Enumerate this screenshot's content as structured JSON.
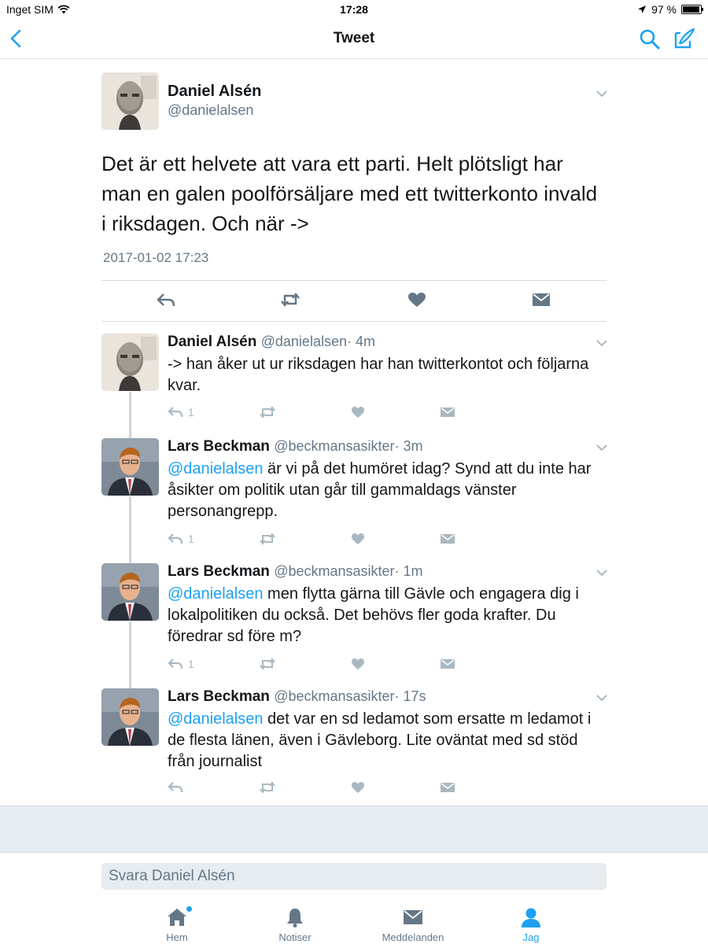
{
  "status_bar": {
    "carrier": "Inget SIM",
    "time": "17:28",
    "battery": "97 %",
    "battery_level": 0.97
  },
  "nav": {
    "title": "Tweet"
  },
  "main_tweet": {
    "name": "Daniel Alsén",
    "handle": "@danielalsen",
    "text": "Det är ett helvete att vara ett parti. Helt plötsligt har man en galen poolförsäljare med ett twitterkonto invald i riksdagen. Och när ->",
    "date": "2017-01-02 17:23"
  },
  "replies": [
    {
      "name": "Daniel Alsén",
      "handle": "@danielalsen",
      "time": "· 4m",
      "mention": "",
      "text": "-> han åker ut ur riksdagen har han twitterkontot och följarna kvar.",
      "reply_count": "1"
    },
    {
      "name": "Lars Beckman",
      "handle": "@beckmansasikter",
      "time": "· 3m",
      "mention": "@danielalsen",
      "text": " är vi på det humöret idag? Synd att du inte har åsikter om politik utan går till gammaldags vänster personangrepp.",
      "reply_count": "1"
    },
    {
      "name": "Lars Beckman",
      "handle": "@beckmansasikter",
      "time": "· 1m",
      "mention": "@danielalsen",
      "text": " men flytta gärna till Gävle och engagera dig i lokalpolitiken du också. Det behövs fler goda krafter. Du föredrar sd före m?",
      "reply_count": "1"
    },
    {
      "name": "Lars Beckman",
      "handle": "@beckmansasikter",
      "time": "· 17s",
      "mention": "@danielalsen",
      "text": " det var en sd ledamot som ersatte m ledamot i de flesta länen, även i Gävleborg. Lite oväntat med sd stöd från journalist",
      "reply_count": ""
    }
  ],
  "reply_box": {
    "placeholder": "Svara Daniel Alsén"
  },
  "tabs": [
    {
      "label": "Hem",
      "icon": "home-icon"
    },
    {
      "label": "Notiser",
      "icon": "bell-icon"
    },
    {
      "label": "Meddelanden",
      "icon": "envelope-icon"
    },
    {
      "label": "Jag",
      "icon": "person-icon",
      "active": true
    }
  ],
  "colors": {
    "accent": "#1da1f2",
    "text": "#14171a",
    "secondary": "#657786",
    "icon_gray": "#aab8c2",
    "background_gray": "#e6ecf0"
  }
}
